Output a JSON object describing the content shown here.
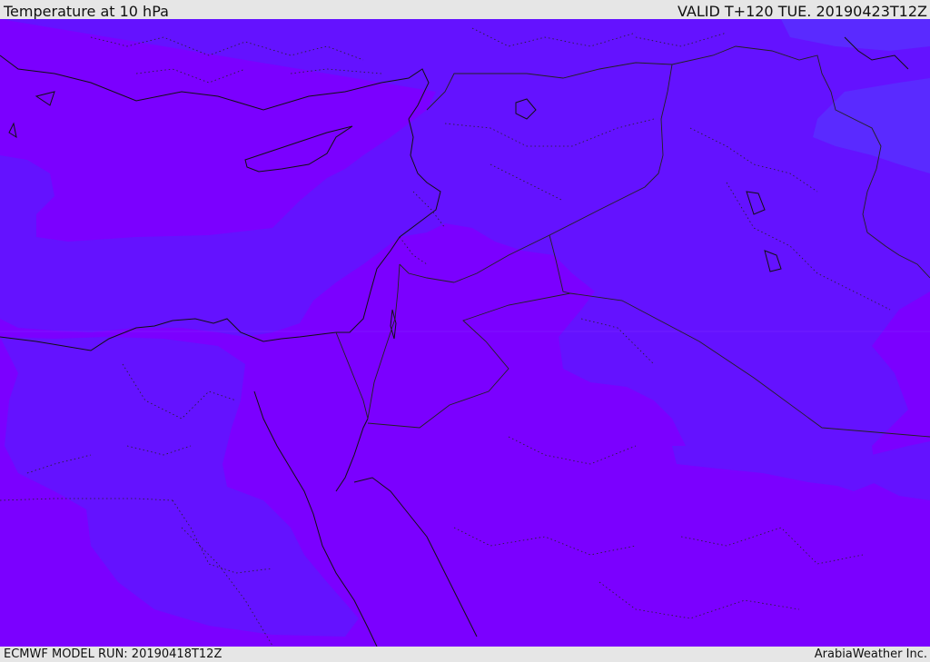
{
  "header": {
    "title": "Temperature at 10 hPa",
    "valid_time": "VALID T+120 TUE. 20190423T12Z"
  },
  "footer": {
    "model_run": "ECMWF MODEL RUN: 20190418T12Z",
    "credit": "ArabiaWeather Inc."
  },
  "colors": {
    "field_warm": "#7b00ff",
    "field_cool": "#6412ff",
    "field_cooler": "#5a2aff",
    "coastline": "#111111",
    "border": "#222222",
    "frame": "#e6e6e6"
  }
}
